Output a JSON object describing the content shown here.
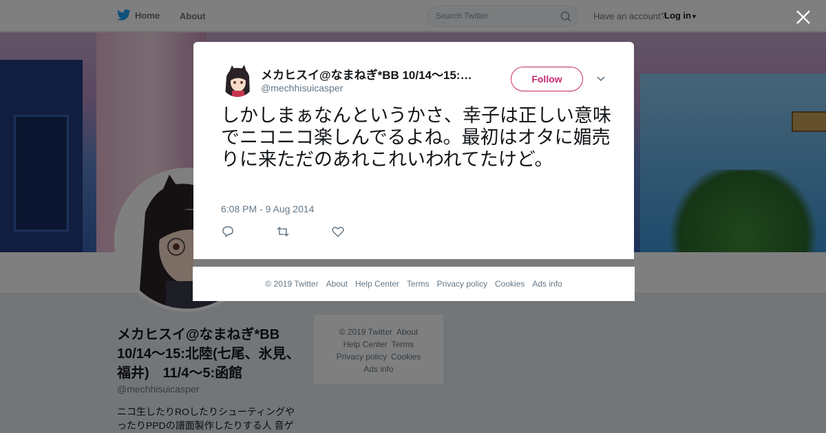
{
  "nav": {
    "home_label": "Home",
    "about_label": "About",
    "search_placeholder": "Search Twitter",
    "account_text": "Have an account?",
    "login_label": "Log in"
  },
  "profile": {
    "name": "メカヒスイ@なまねぎ*BB 10/14～15:北陸(七尾、氷見、福井)　11/4～5:函館",
    "handle": "@mechhisuicasper",
    "bio": "ニコ生したりROしたりシューティングやったりPPDの譜面製作したりする人 音ゲ"
  },
  "side_footer": {
    "row1": [
      "© 2019 Twitter",
      "About"
    ],
    "row2": [
      "Help Center",
      "Terms"
    ],
    "row3": [
      "Privacy policy",
      "Cookies"
    ],
    "row4": [
      "Ads info"
    ]
  },
  "tweet": {
    "name": "メカヒスイ@なまねぎ*BB 10/14～15:北陸(七尾、氷見、福井)　11/4～5:函館",
    "handle": "@mechhisuicasper",
    "follow_label": "Follow",
    "text": "しかしまぁなんというかさ、幸子は正しい意味でニコニコ楽しんでるよね。最初はオタに媚売りに来ただのあれこれいわれてたけど。",
    "timestamp": "6:08 PM - 9 Aug 2014"
  },
  "footer": {
    "links": [
      "© 2019 Twitter",
      "About",
      "Help Center",
      "Terms",
      "Privacy policy",
      "Cookies",
      "Ads info"
    ]
  },
  "colors": {
    "follow_accent": "#c6296d",
    "twitter_blue": "#1da1f2",
    "overlay": "rgba(0,0,0,0.5)"
  },
  "icons": [
    "twitter-bird-icon",
    "search-icon",
    "caret-down-icon",
    "close-icon",
    "reply-icon",
    "retweet-icon",
    "like-icon",
    "chevron-down-icon"
  ]
}
